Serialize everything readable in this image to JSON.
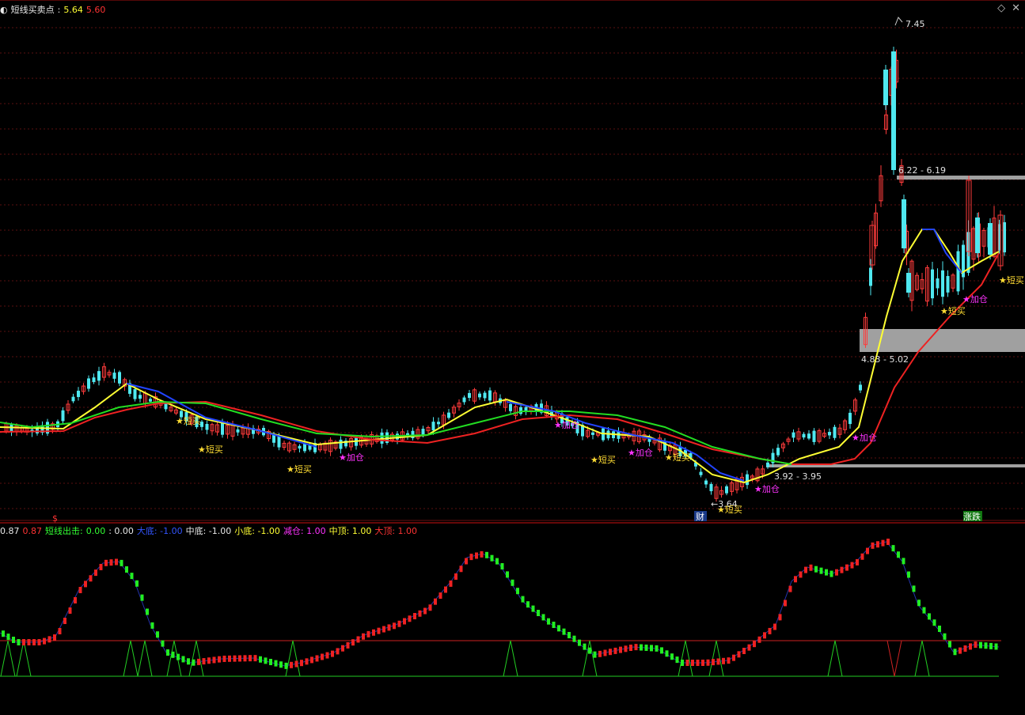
{
  "header": {
    "menu_icon": "chevron-icon",
    "title": "短线买卖点",
    "sep": ":",
    "value_a": "5.64",
    "value_b": "5.60"
  },
  "window_controls": {
    "settings": "◇",
    "close": "✕"
  },
  "price_labels": {
    "high": "7.45",
    "upper_zone": "6.22 - 6.19",
    "mid_zone": "4.83 - 5.02",
    "low_zone": "3.92 - 3.95",
    "low": "3.64"
  },
  "signals": {
    "buy": "★短买",
    "add": "★加仓"
  },
  "markers": {
    "cai": "财",
    "s": "$",
    "rise_fall": "涨跌"
  },
  "indicator_header": {
    "v1": "0.87",
    "v2": "0.87",
    "short_out_label": "短线出击:",
    "short_out_val": "0.00",
    "sep_val": ": 0.00",
    "big_bottom": "大底: -1.00",
    "mid_bottom": "中底: -1.00",
    "small_bottom": "小底: -1.00",
    "reduce": "减仓: 1.00",
    "mid_top": "中顶: 1.00",
    "big_top": "大顶: 1.00"
  },
  "colors": {
    "up": "#ff3b3b",
    "down": "#4fe8f0",
    "ma_yellow": "#ffff33",
    "ma_red": "#ee2222",
    "ma_green": "#22dd22",
    "ma_blue": "#2244ff",
    "zone": "#a0a0a0"
  }
}
